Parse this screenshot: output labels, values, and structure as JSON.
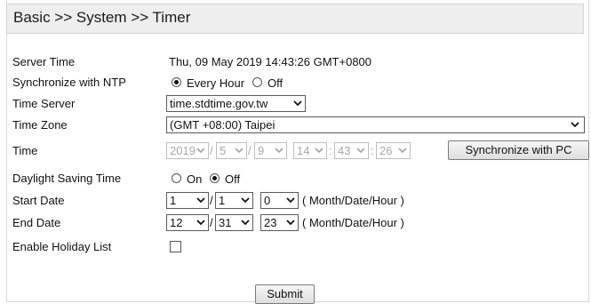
{
  "breadcrumb": "Basic >> System >> Timer",
  "rows": {
    "server_time": {
      "label": "Server Time",
      "value": "Thu, 09 May 2019 14:43:26 GMT+0800"
    },
    "ntp": {
      "label": "Synchronize with NTP",
      "options": [
        "Every Hour",
        "Off"
      ],
      "selected": "Every Hour"
    },
    "time_server": {
      "label": "Time Server",
      "value": "time.stdtime.gov.tw"
    },
    "time_zone": {
      "label": "Time Zone",
      "value": "(GMT +08:00) Taipei"
    },
    "time": {
      "label": "Time",
      "year": "2019",
      "month": "5",
      "day": "9",
      "hour": "14",
      "minute": "43",
      "second": "26",
      "date_sep": "/",
      "time_sep": ":",
      "sync_button": "Synchronize with PC"
    },
    "dst": {
      "label": "Daylight Saving Time",
      "options": [
        "On",
        "Off"
      ],
      "selected": "Off"
    },
    "start_date": {
      "label": "Start Date",
      "month": "1",
      "date": "1",
      "hour": "0",
      "hint": "( Month/Date/Hour )"
    },
    "end_date": {
      "label": "End Date",
      "month": "12",
      "date": "31",
      "hour": "23",
      "hint": "( Month/Date/Hour )"
    },
    "holiday": {
      "label": "Enable Holiday List",
      "checked": false
    }
  },
  "submit_label": "Submit",
  "icons": {
    "dropdown": "chevron-down-icon"
  }
}
